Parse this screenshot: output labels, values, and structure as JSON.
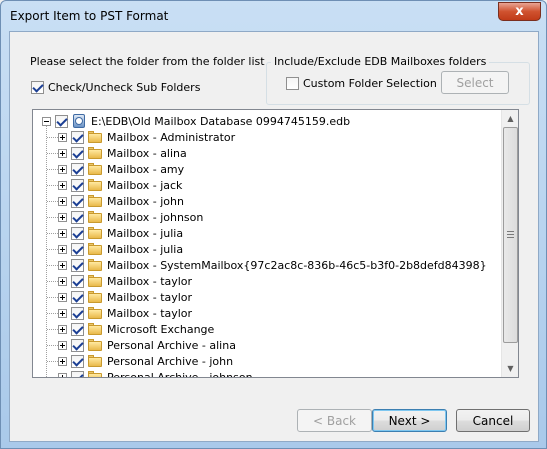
{
  "window": {
    "title": "Export Item to PST Format",
    "close_glyph": "x"
  },
  "left": {
    "instruction": "Please select the folder from the folder list",
    "check_sub_label": "Check/Uncheck Sub Folders",
    "check_sub_checked": true
  },
  "right": {
    "group_label": "Include/Exclude EDB Mailboxes folders",
    "custom_label": "Custom Folder Selection",
    "custom_checked": false,
    "select_button": "Select"
  },
  "tree": {
    "root": {
      "label": "E:\\EDB\\Old Mailbox Database 0994745159.edb",
      "icon": "database-icon",
      "checked": true
    },
    "items": [
      {
        "label": "Mailbox - Administrator",
        "checked": true
      },
      {
        "label": "Mailbox - alina",
        "checked": true
      },
      {
        "label": "Mailbox - amy",
        "checked": true
      },
      {
        "label": "Mailbox - jack",
        "checked": true
      },
      {
        "label": "Mailbox - john",
        "checked": true
      },
      {
        "label": "Mailbox - johnson",
        "checked": true
      },
      {
        "label": "Mailbox - julia",
        "checked": true
      },
      {
        "label": "Mailbox - julia",
        "checked": true
      },
      {
        "label": "Mailbox - SystemMailbox{97c2ac8c-836b-46c5-b3f0-2b8defd84398}",
        "checked": true
      },
      {
        "label": "Mailbox - taylor",
        "checked": true
      },
      {
        "label": "Mailbox - taylor",
        "checked": true
      },
      {
        "label": "Mailbox - taylor",
        "checked": true
      },
      {
        "label": "Microsoft Exchange",
        "checked": true
      },
      {
        "label": "Personal Archive - alina",
        "checked": true
      },
      {
        "label": "Personal Archive - john",
        "checked": true
      },
      {
        "label": "Personal Archive - johnson",
        "checked": true
      }
    ]
  },
  "footer": {
    "back": "< Back",
    "next": "Next >",
    "cancel": "Cancel"
  }
}
